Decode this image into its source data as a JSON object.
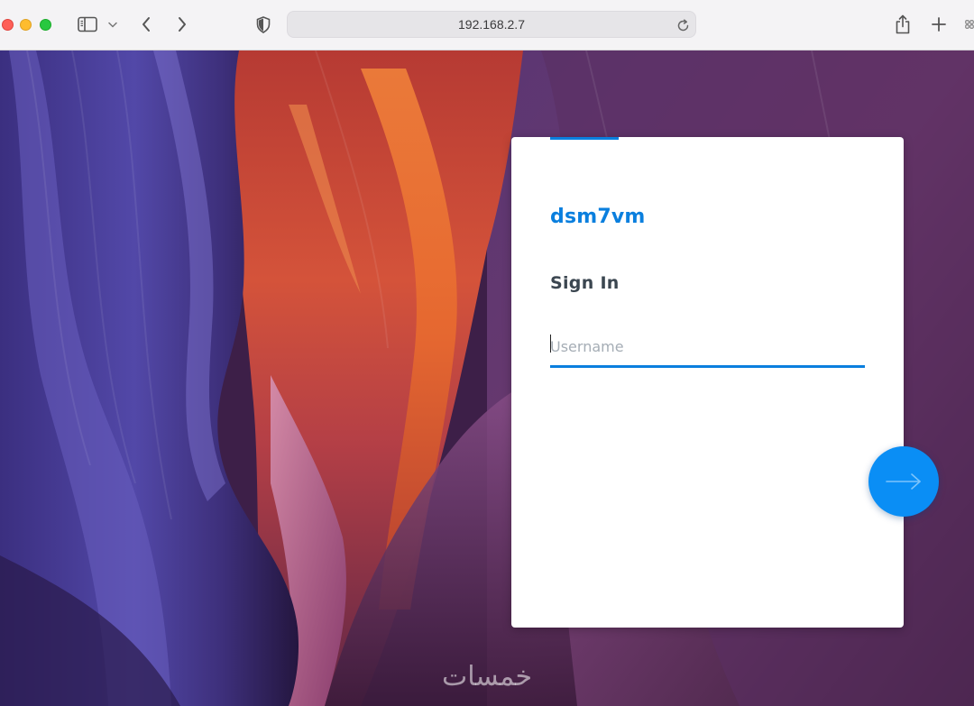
{
  "browser": {
    "url": "192.168.2.7",
    "icons": {
      "sidebar": "sidebar-icon",
      "sidebar_menu": "chevron-down-icon",
      "back": "chevron-left-icon",
      "forward": "chevron-right-icon",
      "privacy": "shield-icon",
      "reload": "reload-icon",
      "share": "share-icon",
      "new_tab": "plus-icon",
      "tab_overview": "tab-overview-icon"
    }
  },
  "login": {
    "hostname": "dsm7vm",
    "title": "Sign In",
    "username": {
      "value": "",
      "placeholder": "Username"
    },
    "submit_icon": "arrow-right-icon"
  },
  "watermark": "خمسات",
  "colors": {
    "accent": "#0a7fde",
    "submit": "#0a8ef5",
    "title": "#3b4650",
    "toolbar": "#f4f3f5"
  }
}
